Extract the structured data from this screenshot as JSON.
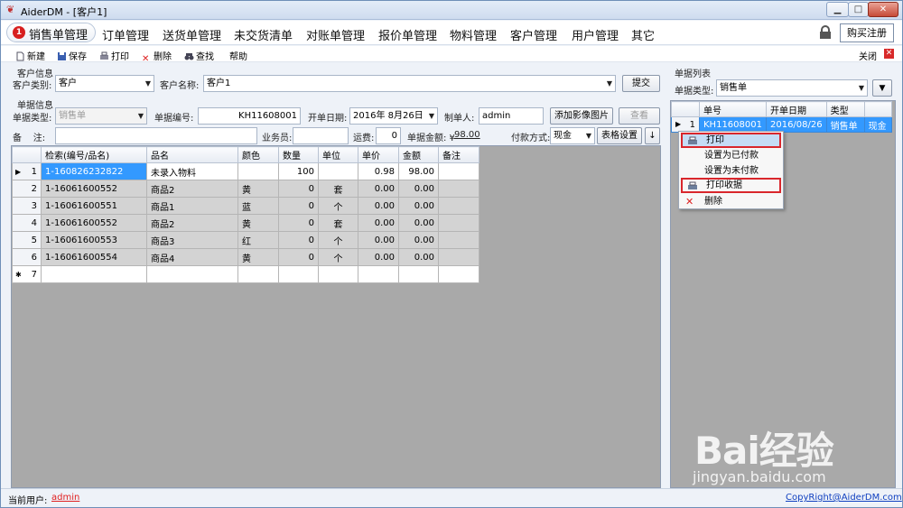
{
  "window": {
    "title": "AiderDM - [客户1]",
    "min": "▁",
    "max": "□",
    "close": "✕"
  },
  "menu": {
    "items": [
      "销售单管理",
      "订单管理",
      "送货单管理",
      "未交货清单",
      "对账单管理",
      "报价单管理",
      "物料管理",
      "客户管理",
      "用户管理",
      "其它"
    ],
    "badge": "1",
    "buy": "购买注册"
  },
  "toolbar": {
    "new": "新建",
    "save": "保存",
    "print": "打印",
    "delete": "删除",
    "find": "查找",
    "help": "帮助",
    "close": "关闭"
  },
  "customer": {
    "section": "客户信息",
    "type_label": "客户类别:",
    "type_value": "客户",
    "name_label": "客户名称:",
    "name_value": "客户1",
    "submit": "提交"
  },
  "doc": {
    "section": "单据信息",
    "dtype_label": "单据类型:",
    "dtype_value": "销售单",
    "no_label": "单据编号:",
    "no_value": "KH11608001",
    "date_label": "开单日期:",
    "date_value": "2016年  8月26日",
    "maker_label": "制单人:",
    "maker_value": "admin",
    "add_image": "添加影像图片",
    "view": "查看",
    "note_label": "备    注:",
    "sales_label": "业务员:",
    "freight_label": "运费:",
    "freight_value": "0",
    "amount_label": "单据金额: ¥",
    "amount_value": "98.00",
    "pay_label": "付款方式:",
    "pay_value": "现金",
    "grid_settings": "表格设置",
    "down": "↓"
  },
  "grid": {
    "headers": [
      "检索(编号/品名)",
      "品名",
      "颜色",
      "数量",
      "单位",
      "单价",
      "金额",
      "备注"
    ],
    "rows": [
      {
        "n": "1",
        "code": "1-160826232822",
        "name": "未录入物料",
        "color": "",
        "qty": "100",
        "unit": "",
        "price": "0.98",
        "amount": "98.00",
        "note": ""
      },
      {
        "n": "2",
        "code": "1-16061600552",
        "name": "商品2",
        "color": "黄",
        "qty": "0",
        "unit": "套",
        "price": "0.00",
        "amount": "0.00",
        "note": ""
      },
      {
        "n": "3",
        "code": "1-16061600551",
        "name": "商品1",
        "color": "蓝",
        "qty": "0",
        "unit": "个",
        "price": "0.00",
        "amount": "0.00",
        "note": ""
      },
      {
        "n": "4",
        "code": "1-16061600552",
        "name": "商品2",
        "color": "黄",
        "qty": "0",
        "unit": "套",
        "price": "0.00",
        "amount": "0.00",
        "note": ""
      },
      {
        "n": "5",
        "code": "1-16061600553",
        "name": "商品3",
        "color": "红",
        "qty": "0",
        "unit": "个",
        "price": "0.00",
        "amount": "0.00",
        "note": ""
      },
      {
        "n": "6",
        "code": "1-16061600554",
        "name": "商品4",
        "color": "黄",
        "qty": "0",
        "unit": "个",
        "price": "0.00",
        "amount": "0.00",
        "note": ""
      }
    ],
    "new_row": "7"
  },
  "list": {
    "section": "单据列表",
    "type_label": "单据类型:",
    "type_value": "销售单",
    "headers": [
      "单号",
      "开单日期",
      "类型",
      ""
    ],
    "row": {
      "n": "1",
      "no": "KH11608001",
      "date": "2016/08/26",
      "type": "销售单",
      "pay": "现金"
    }
  },
  "context_menu": [
    "打印",
    "设置为已付款",
    "设置为未付款",
    "打印收据",
    "删除"
  ],
  "status": {
    "user_label": "当前用户:",
    "user": "admin",
    "copyright": "CopyRight@AiderDM.com"
  },
  "watermark": {
    "brand": "Bai经验",
    "url": "jingyan.baidu.com"
  }
}
